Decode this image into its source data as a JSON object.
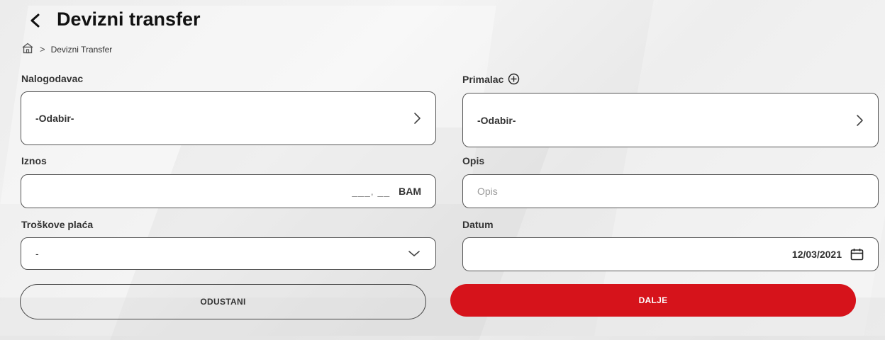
{
  "header": {
    "title": "Devizni transfer",
    "breadcrumb": {
      "current": "Devizni Transfer"
    }
  },
  "form": {
    "nalogodavac": {
      "label": "Nalogodavac",
      "value": "-Odabir-"
    },
    "primalac": {
      "label": "Primalac",
      "value": "-Odabir-"
    },
    "iznos": {
      "label": "Iznos",
      "mask": "___, __",
      "currency": "BAM"
    },
    "opis": {
      "label": "Opis",
      "placeholder": "Opis"
    },
    "troskove": {
      "label": "Troškove plaća",
      "value": "-"
    },
    "datum": {
      "label": "Datum",
      "value": "12/03/2021"
    }
  },
  "actions": {
    "cancel_label": "ODUSTANI",
    "next_label": "DALJE"
  },
  "colors": {
    "accent": "#d6131b",
    "text": "#222222"
  },
  "icons": [
    "back-arrow-icon",
    "home-icon",
    "chevron-right-icon",
    "plus-circle-icon",
    "chevron-down-icon",
    "calendar-icon"
  ]
}
